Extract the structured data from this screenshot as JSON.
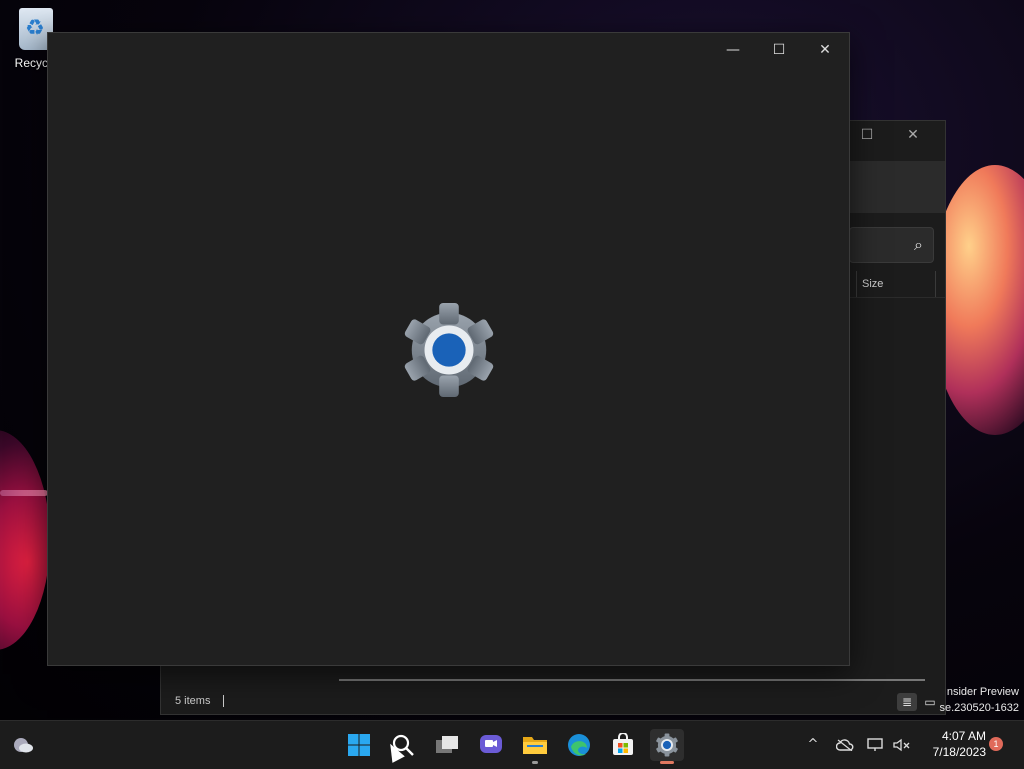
{
  "desktop": {
    "recycle_label": "Recycle"
  },
  "explorer": {
    "column_size": "Size",
    "status_items": "5 items",
    "search_icon": "search-icon"
  },
  "watermark": {
    "line1": "nsider Preview",
    "line2": "se.230520-1632"
  },
  "settings_window": {
    "minimize": "—",
    "maximize": "☐",
    "close": "✕",
    "splash_icon": "settings-gear-icon",
    "accent_color": "#1a62b8"
  },
  "taskbar": {
    "icons": [
      "weather",
      "start",
      "search",
      "task-view",
      "chat",
      "file-explorer",
      "edge",
      "store",
      "settings"
    ],
    "time": "4:07 AM",
    "date": "7/18/2023",
    "notification_count": "1"
  }
}
